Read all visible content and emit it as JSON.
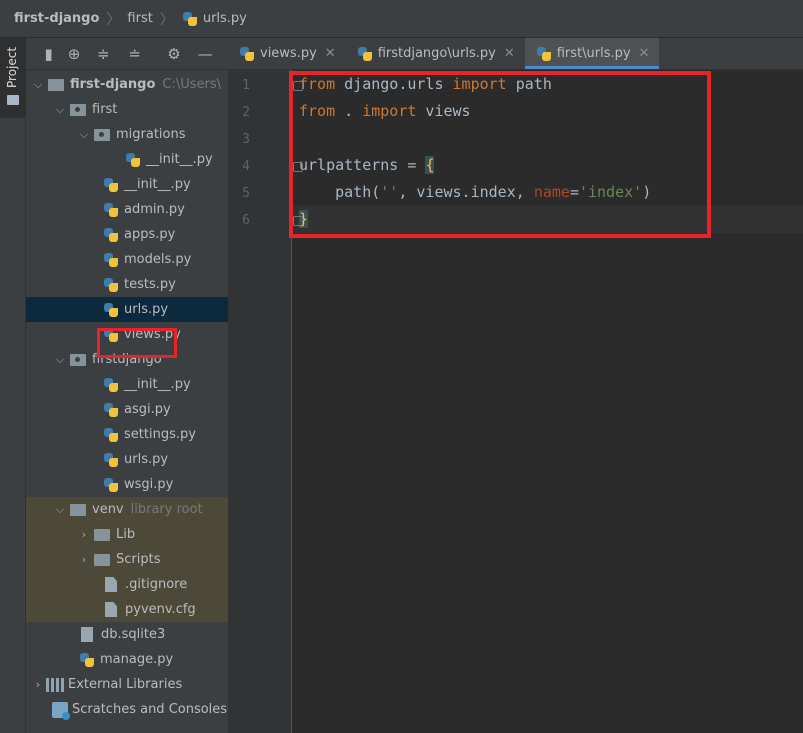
{
  "breadcrumb": {
    "project": "first-django",
    "folder": "first",
    "file": "urls.py"
  },
  "toolwindow": {
    "project_tab_label": "Project"
  },
  "toolbar_icons": [
    "sidebar-toggle-icon",
    "locate-icon",
    "expand-all-icon",
    "collapse-all-icon",
    "gear-icon",
    "minimize-icon"
  ],
  "tree": {
    "root_name": "first-django",
    "root_path": "C:\\Users\\",
    "first": "first",
    "migrations": "migrations",
    "migrations_init": "__init__.py",
    "first_init": "__init__.py",
    "admin": "admin.py",
    "apps": "apps.py",
    "models": "models.py",
    "tests": "tests.py",
    "urls": "urls.py",
    "views": "views.py",
    "firstdjango": "firstdjango",
    "fd_init": "__init__.py",
    "asgi": "asgi.py",
    "settings": "settings.py",
    "fd_urls": "urls.py",
    "wsgi": "wsgi.py",
    "venv": "venv",
    "venv_hint": "library root",
    "lib": "Lib",
    "scripts": "Scripts",
    "gitignore": ".gitignore",
    "pyvenv": "pyvenv.cfg",
    "db": "db.sqlite3",
    "manage": "manage.py",
    "external": "External Libraries",
    "scratches": "Scratches and Consoles"
  },
  "tabs": [
    {
      "label": "views.py"
    },
    {
      "label": "firstdjango\\urls.py"
    },
    {
      "label": "first\\urls.py"
    }
  ],
  "editor": {
    "line_numbers": [
      "1",
      "2",
      "3",
      "4",
      "5",
      "6"
    ],
    "l1_from": "from",
    "l1_mod": " django.urls ",
    "l1_import": "import",
    "l1_name": " path",
    "l2_from": "from",
    "l2_mod": " . ",
    "l2_import": "import",
    "l2_name": " views",
    "l4_var": "urlpatterns = ",
    "l4_open": "{",
    "l5_call": "    path(",
    "l5_str": "''",
    "l5_mid": ", views.index, ",
    "l5_param": "name",
    "l5_eq": "=",
    "l5_str2": "'index'",
    "l5_close": ")",
    "l6_close": "}"
  },
  "colors": {
    "keyword": "#cc7832",
    "string": "#6a8759",
    "highlight_box": "#e8232a",
    "selection": "#0d293e"
  }
}
